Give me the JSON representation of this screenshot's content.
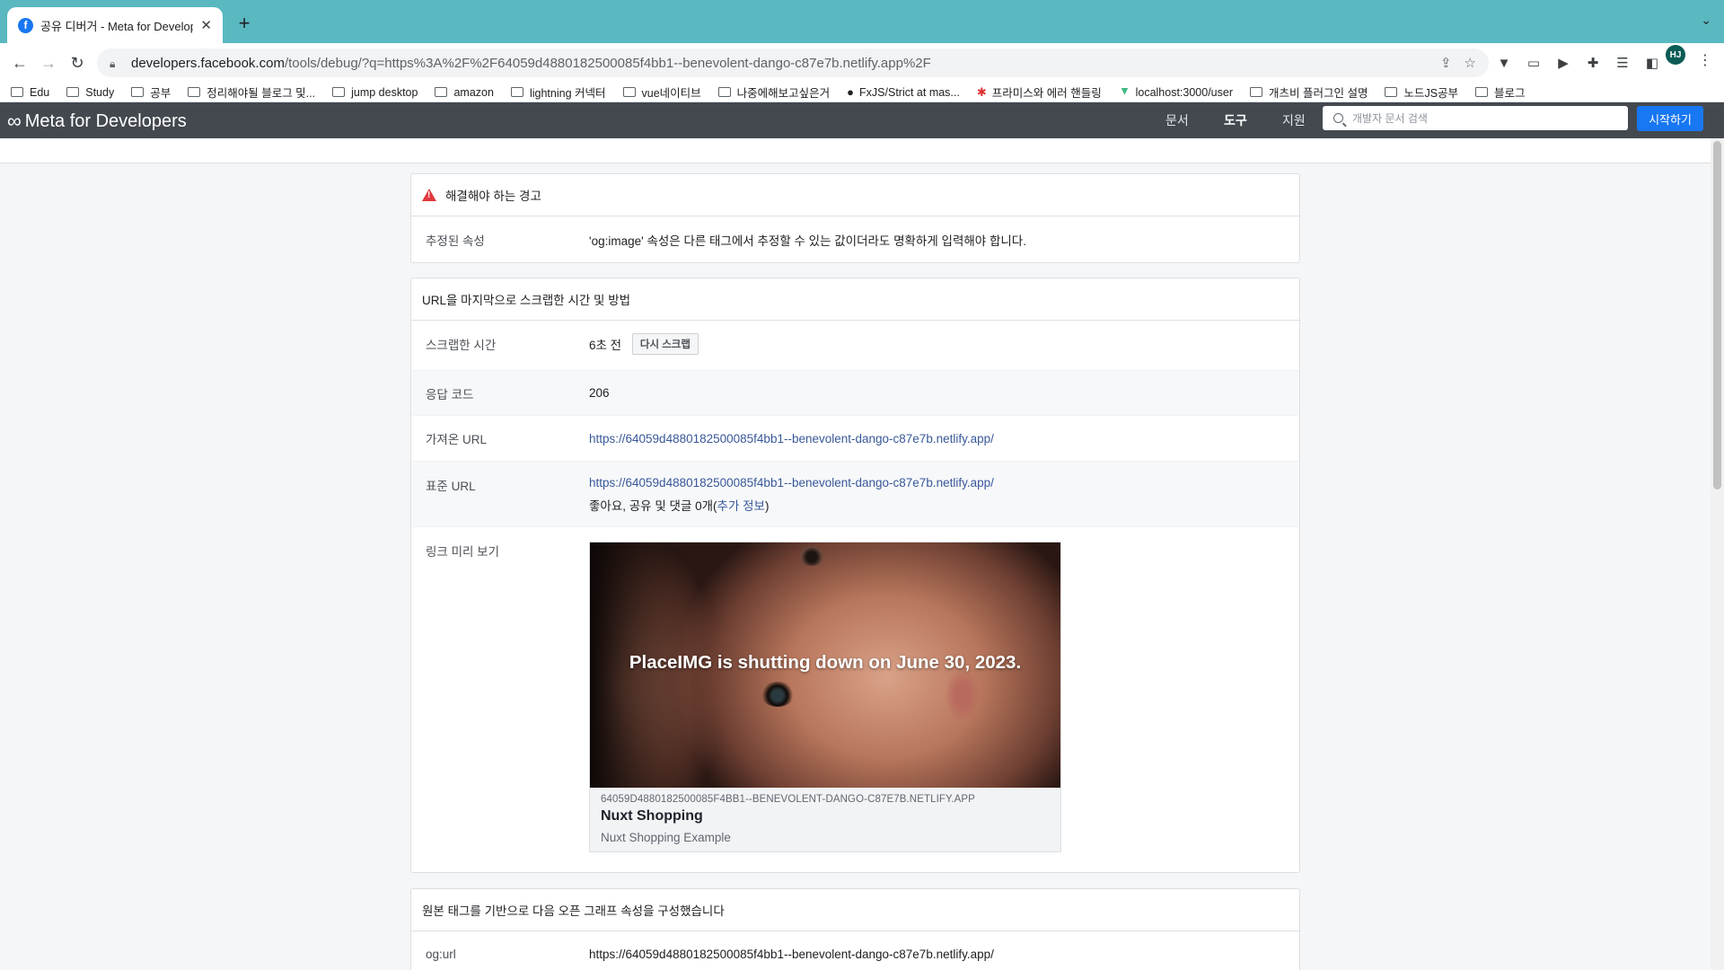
{
  "browser": {
    "tab_title": "공유 디버거 - Meta for Developer",
    "tab_favicon": "f",
    "url_host": "developers.facebook.com",
    "url_path": "/tools/debug/?q=https%3A%2F%2F64059d4880182500085f4bb1--benevolent-dango-c87e7b.netlify.app%2F",
    "profile_initials": "HJ",
    "bookmarks": [
      {
        "label": "Edu",
        "icon": "folder"
      },
      {
        "label": "Study",
        "icon": "folder"
      },
      {
        "label": "공부",
        "icon": "folder"
      },
      {
        "label": "정리해야될 블로그 및...",
        "icon": "folder"
      },
      {
        "label": "jump desktop",
        "icon": "folder"
      },
      {
        "label": "amazon",
        "icon": "folder"
      },
      {
        "label": "lightning 커넥터",
        "icon": "folder"
      },
      {
        "label": "vue네이티브",
        "icon": "folder"
      },
      {
        "label": "나중에해보고싶은거",
        "icon": "folder"
      },
      {
        "label": "FxJS/Strict at mas...",
        "icon": "github"
      },
      {
        "label": "프라미스와 에러 핸들링",
        "icon": "javascript-info"
      },
      {
        "label": "localhost:3000/user",
        "icon": "vue"
      },
      {
        "label": "개츠비 플러그인 설명",
        "icon": "folder"
      },
      {
        "label": "노드JS공부",
        "icon": "folder"
      },
      {
        "label": "블로그",
        "icon": "folder"
      }
    ]
  },
  "site": {
    "brand": "Meta for Developers",
    "nav": {
      "docs": "문서",
      "tools": "도구",
      "support": "지원"
    },
    "search_placeholder": "개발자 문서 검색",
    "cta": "시작하기"
  },
  "warnings": {
    "title": "해결해야 하는 경고",
    "rows": [
      {
        "label": "추정된 속성",
        "value": "'og:image' 속성은 다른 태그에서 추정할 수 있는 값이더라도 명확하게 입력해야 합니다."
      }
    ]
  },
  "scrape": {
    "title": "URL을 마지막으로 스크랩한 시간 및 방법",
    "time_label": "스크랩한 시간",
    "time_value": "6초 전",
    "rescrape_button": "다시 스크랩",
    "response_label": "응답 코드",
    "response_value": "206",
    "fetched_label": "가져온 URL",
    "fetched_value": "https://64059d4880182500085f4bb1--benevolent-dango-c87e7b.netlify.app/",
    "canonical_label": "표준 URL",
    "canonical_value": "https://64059d4880182500085f4bb1--benevolent-dango-c87e7b.netlify.app/",
    "engagement_prefix": "좋아요, 공유 및 댓글 0개(",
    "engagement_link": "추가 정보",
    "engagement_suffix": ")",
    "preview_label": "링크 미리 보기",
    "preview": {
      "image_caption": "PlaceIMG is shutting down on June 30, 2023.",
      "domain": "64059D4880182500085F4BB1--BENEVOLENT-DANGO-C87E7B.NETLIFY.APP",
      "title": "Nuxt Shopping",
      "description": "Nuxt Shopping Example"
    }
  },
  "og": {
    "title": "원본 태그를 기반으로 다음 오픈 그래프 속성을 구성했습니다",
    "rows": [
      {
        "label": "og:url",
        "value": "https://64059d4880182500085f4bb1--benevolent-dango-c87e7b.netlify.app/"
      }
    ]
  },
  "colors": {
    "tabbar": "#5ab8c0",
    "header": "#444950",
    "cta": "#1877f2",
    "link": "#385898",
    "warning": "#e0393e"
  }
}
